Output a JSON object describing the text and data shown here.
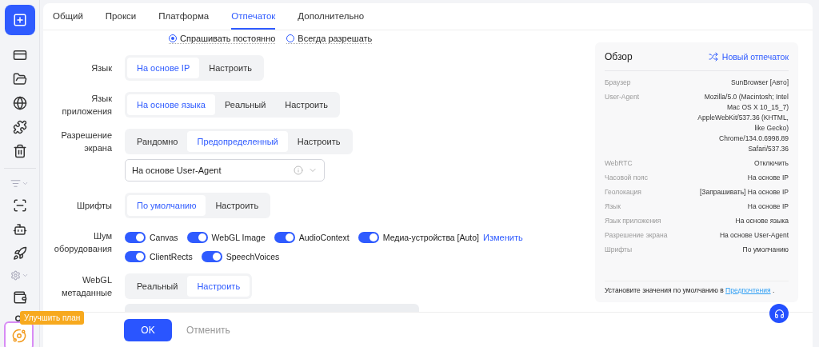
{
  "tabs": [
    {
      "label": "Общий",
      "selected": false
    },
    {
      "label": "Прокси",
      "selected": false
    },
    {
      "label": "Платформа",
      "selected": false
    },
    {
      "label": "Отпечаток",
      "selected": true
    },
    {
      "label": "Дополнительно",
      "selected": false
    }
  ],
  "geolocation_radios": [
    {
      "label": "Спрашивать постоянно",
      "selected": true
    },
    {
      "label": "Всегда разрешать",
      "selected": false
    }
  ],
  "form": [
    {
      "kind": "segmented",
      "label": "Язык",
      "options": [
        {
          "label": "На основе IP",
          "selected": true
        },
        {
          "label": "Настроить",
          "selected": false
        }
      ]
    },
    {
      "kind": "segmented",
      "label": "Язык приложения",
      "options": [
        {
          "label": "На основе языка",
          "selected": true
        },
        {
          "label": "Реальный",
          "selected": false
        },
        {
          "label": "Настроить",
          "selected": false
        }
      ]
    },
    {
      "kind": "segmented",
      "label": "Разрешение экрана",
      "options": [
        {
          "label": "Рандомно",
          "selected": false
        },
        {
          "label": "Предопределенный",
          "selected": true
        },
        {
          "label": "Настроить",
          "selected": false
        }
      ],
      "select_value": "На основе User-Agent"
    },
    {
      "kind": "segmented",
      "label": "Шрифты",
      "options": [
        {
          "label": "По умолчанию",
          "selected": true
        },
        {
          "label": "Настроить",
          "selected": false
        }
      ]
    },
    {
      "kind": "toggles",
      "label": "Шум оборудования",
      "toggles": [
        {
          "label": "Canvas",
          "on": true
        },
        {
          "label": "WebGL Image",
          "on": true
        },
        {
          "label": "AudioContext",
          "on": true
        },
        {
          "label": "Медиа-устройства [Auto]",
          "on": true,
          "link": "Изменить"
        },
        {
          "label": "ClientRects",
          "on": true
        },
        {
          "label": "SpeechVoices",
          "on": true
        }
      ]
    },
    {
      "kind": "segmented",
      "label": "WebGL метаданные",
      "options": [
        {
          "label": "Реальный",
          "selected": false
        },
        {
          "label": "Настроить",
          "selected": true
        }
      ],
      "has_field": true
    }
  ],
  "overview": {
    "title": "Обзор",
    "action": "Новый отпечаток",
    "rows": [
      {
        "key": "Браузер",
        "value": "SunBrowser [Авто]"
      },
      {
        "key": "User-Agent",
        "value": "Mozilla/5.0 (Macintosh; Intel Mac OS X 10_15_7) AppleWebKit/537.36 (KHTML, like Gecko) Chrome/134.0.6998.89 Safari/537.36"
      },
      {
        "key": "WebRTC",
        "value": "Отключить"
      },
      {
        "key": "Часовой пояс",
        "value": "На основе IP"
      },
      {
        "key": "Геолокация",
        "value": "[Запрашивать] На основе IP"
      },
      {
        "key": "Язык",
        "value": "На основе IP"
      },
      {
        "key": "Язык приложения",
        "value": "На основе языка"
      },
      {
        "key": "Разрешение экрана",
        "value": "На основе User-Agent"
      },
      {
        "key": "Шрифты",
        "value": "По умолчанию"
      }
    ],
    "footer_text": "Установите значения по умолчанию в",
    "footer_link": "Предпочтения",
    "footer_end": "."
  },
  "upgrade_tooltip": "Улучшить план",
  "buttons": [
    {
      "label": "OK",
      "kind": "primary"
    },
    {
      "label": "Отменить",
      "kind": "text"
    }
  ]
}
